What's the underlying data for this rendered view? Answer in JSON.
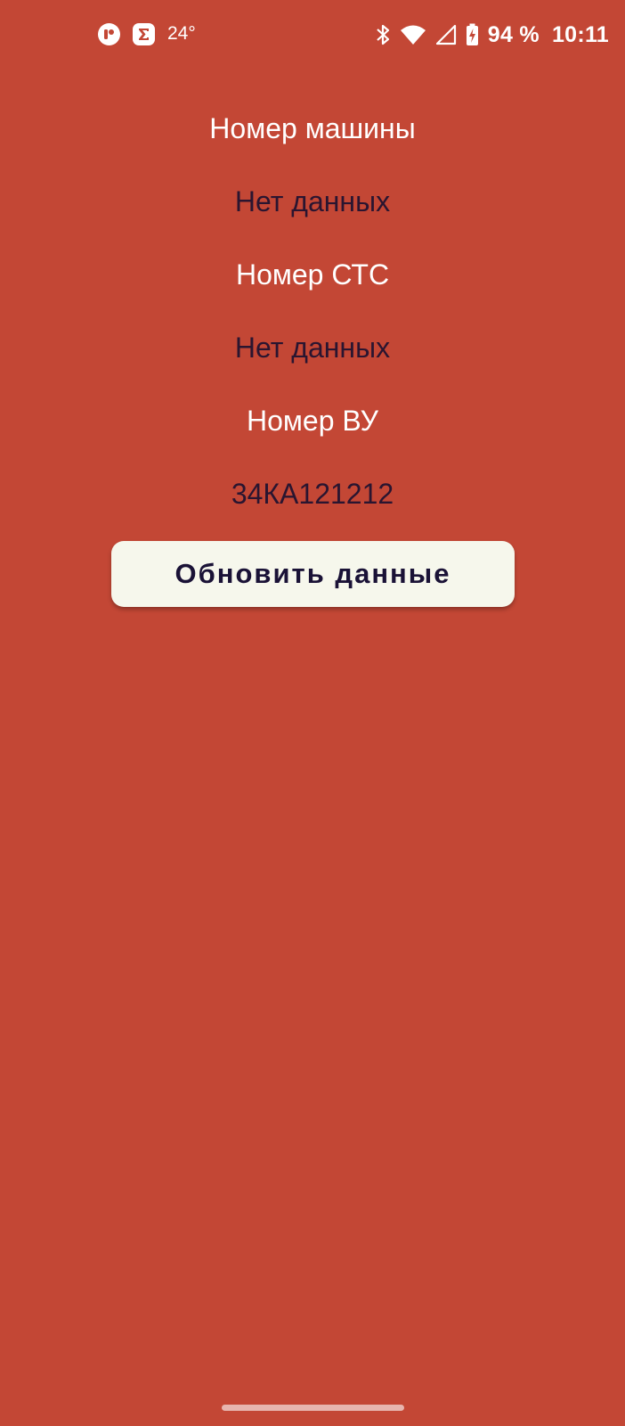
{
  "status_bar": {
    "notification_icons": [
      "app-badge-icon",
      "sigma-app-icon"
    ],
    "temperature": "24°",
    "battery_percent": "94 %",
    "time": "10:11",
    "system_icons": [
      "bluetooth-icon",
      "wifi-icon",
      "cell-signal-icon",
      "battery-charging-icon"
    ]
  },
  "fields": [
    {
      "label": "Номер машины",
      "value": "Нет данных"
    },
    {
      "label": "Номер СТС",
      "value": "Нет данных"
    },
    {
      "label": "Номер ВУ",
      "value": "34КА121212"
    }
  ],
  "actions": {
    "refresh_label": "Обновить данные"
  },
  "colors": {
    "background": "#C34735",
    "label_text": "#FFFFFF",
    "value_text": "#2A1530",
    "button_background": "#F6F7EC",
    "button_text": "#1A1236"
  }
}
